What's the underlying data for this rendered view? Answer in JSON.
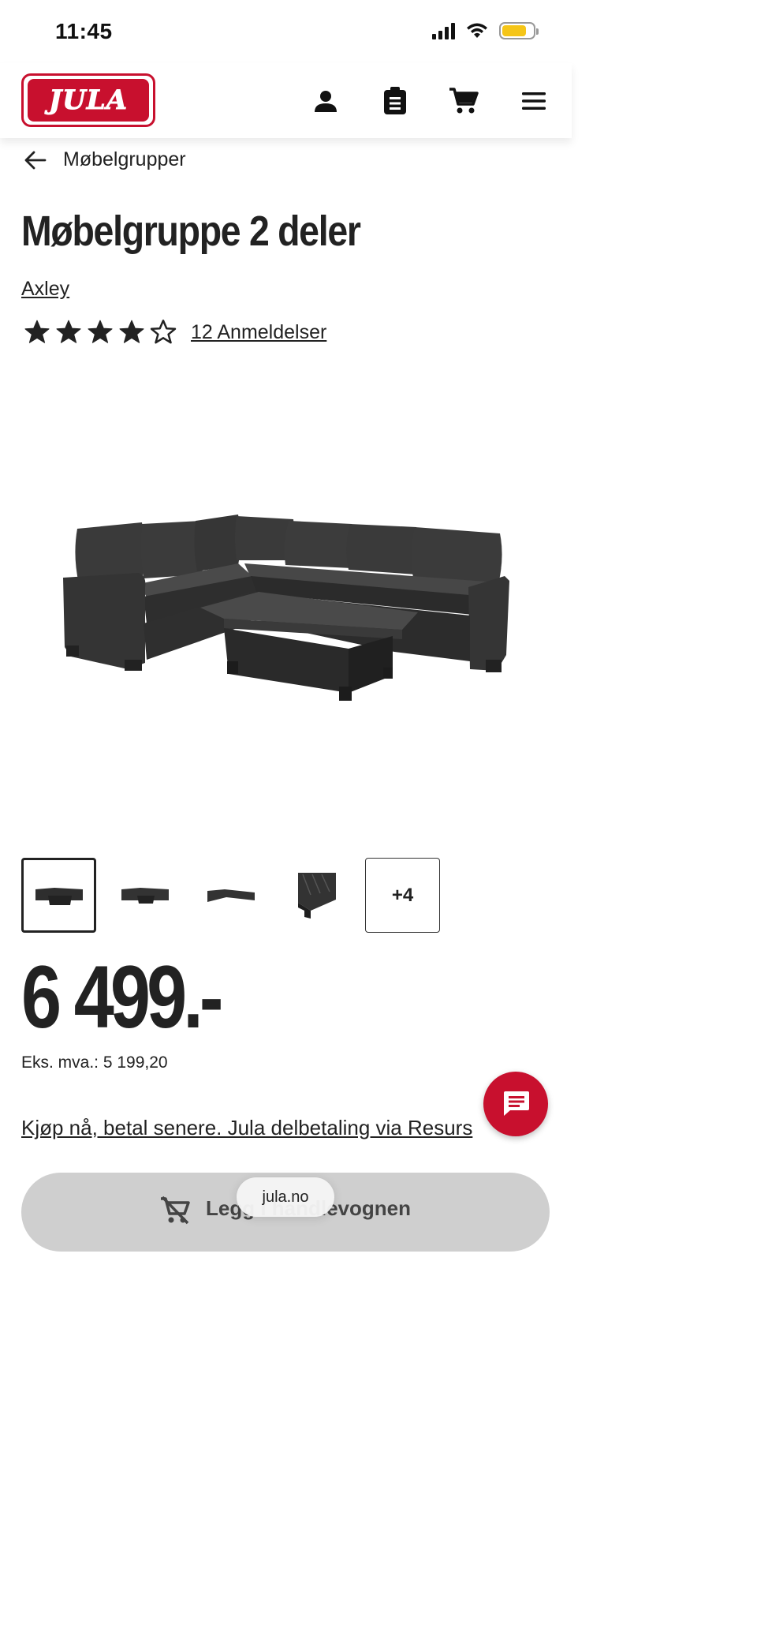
{
  "status_bar": {
    "time": "11:45",
    "battery_level": 0.8,
    "battery_color": "#f5c518"
  },
  "header": {
    "logo_text": "JULA",
    "brand_color": "#c8102e",
    "icons": [
      "user-icon",
      "clipboard-icon",
      "cart-icon",
      "menu-icon"
    ]
  },
  "breadcrumb": {
    "label": "Møbelgrupper"
  },
  "product": {
    "title": "Møbelgruppe 2 deler",
    "brand": "Axley",
    "rating": 4,
    "rating_max": 5,
    "reviews_label": "12 Anmeldelser",
    "thumbnails_more": "+4",
    "price": "6 499.-",
    "ex_vat": "Eks. mva.: 5 199,20",
    "finance_text": "Kjøp nå, betal senere. Jula delbetaling via Resurs",
    "add_to_cart": "Legg i handlevognen"
  },
  "browser": {
    "url": "jula.no"
  }
}
